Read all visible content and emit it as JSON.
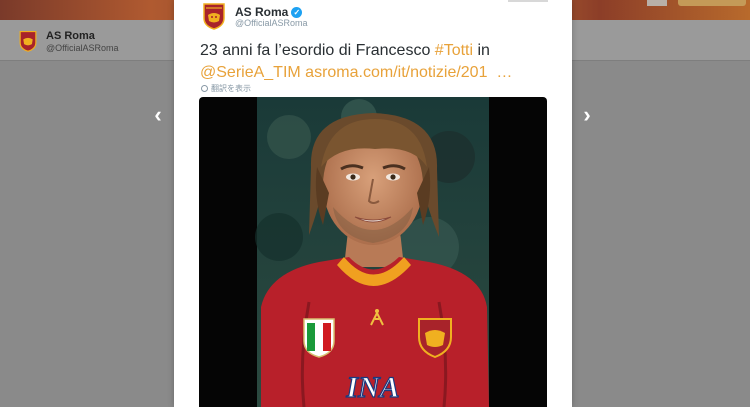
{
  "background": {
    "account_name": "AS Roma",
    "account_handle": "@OfficialASRoma"
  },
  "navigation": {
    "prev_icon": "chevron-left-icon",
    "next_icon": "chevron-right-icon",
    "prev_glyph": "‹",
    "next_glyph": "›"
  },
  "tweet": {
    "author_name": "AS Roma",
    "author_handle": "@OfficialASRoma",
    "verified_icon": "verified-badge-icon",
    "verified_glyph": "✓",
    "text_part1": "23 anni fa l’esordio di Francesco ",
    "hashtag": "#Totti",
    "text_part2": " in",
    "mention": "@SerieA_TIM",
    "url": "asroma.com/it/notizie/201",
    "ellipsis": "…",
    "translate_label": "翻訳を表示",
    "photo_alt": "Francesco Totti in red AS Roma jersey with INA sponsor",
    "sponsor_text": "INA"
  },
  "colors": {
    "accent_link": "#e8a23a",
    "roma_red": "#a8232a",
    "roma_gold": "#f0b020",
    "verified_blue": "#1da1f2"
  }
}
